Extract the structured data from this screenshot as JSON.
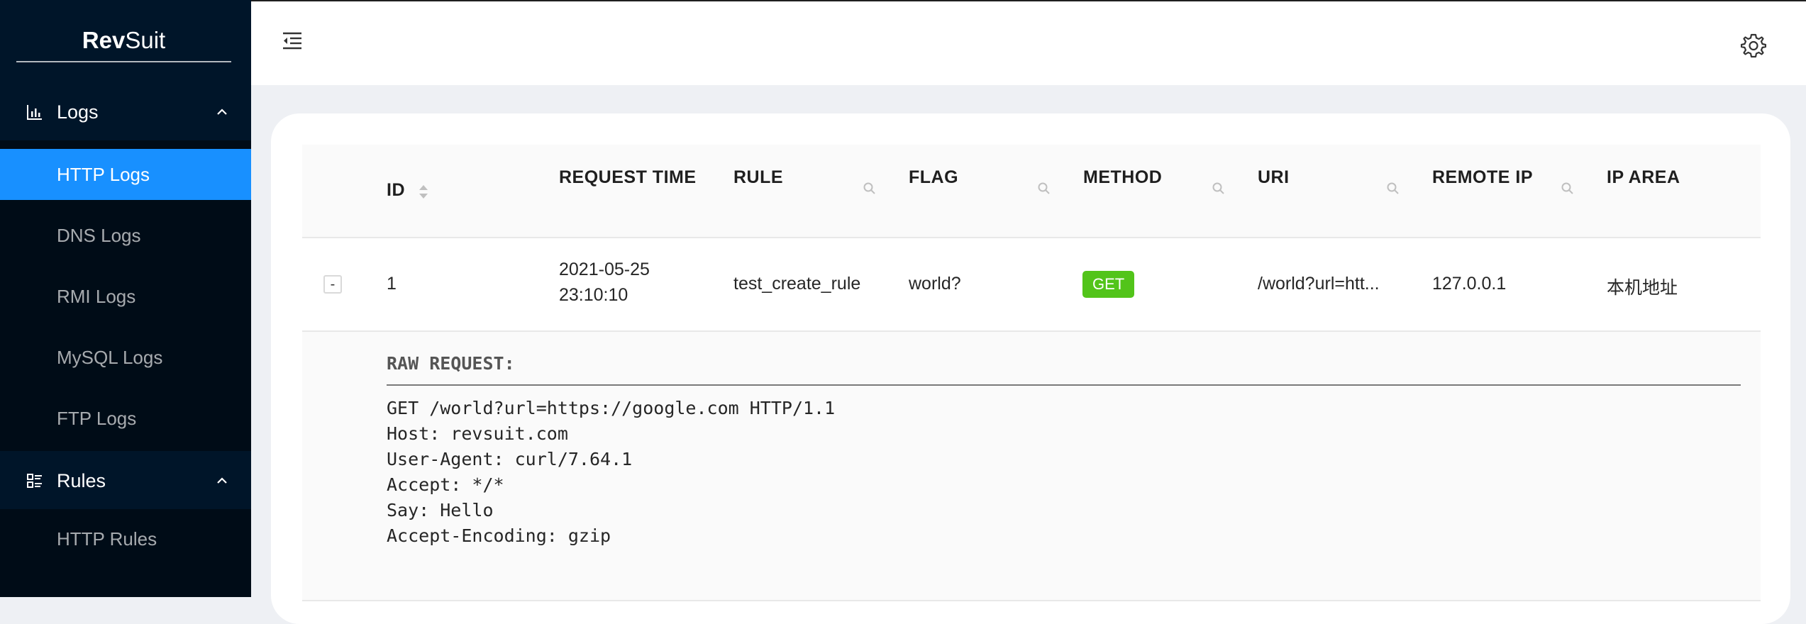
{
  "brand": {
    "bold": "Rev",
    "rest": "Suit"
  },
  "sidebar": {
    "groups": [
      {
        "label": "Logs",
        "icon": "bar-chart-icon",
        "items": [
          {
            "label": "HTTP Logs",
            "active": true
          },
          {
            "label": "DNS Logs"
          },
          {
            "label": "RMI Logs"
          },
          {
            "label": "MySQL Logs"
          },
          {
            "label": "FTP Logs"
          }
        ]
      },
      {
        "label": "Rules",
        "icon": "list-icon",
        "items": [
          {
            "label": "HTTP Rules"
          }
        ]
      }
    ]
  },
  "header": {
    "left_icon": "menu-fold-icon",
    "right_icon": "gear-icon"
  },
  "table": {
    "columns": [
      "ID",
      "REQUEST TIME",
      "RULE",
      "FLAG",
      "METHOD",
      "URI",
      "REMOTE IP",
      "IP AREA"
    ],
    "rows": [
      {
        "expand_symbol": "-",
        "id": "1",
        "time_date": "2021-05-25",
        "time_clock": "23:10:10",
        "rule": "test_create_rule",
        "flag": "world?",
        "method": "GET",
        "uri": "/world?url=htt...",
        "remote_ip": "127.0.0.1",
        "ip_area": "本机地址"
      }
    ],
    "expanded": {
      "title": "RAW REQUEST:",
      "body": "GET /world?url=https://google.com HTTP/1.1\nHost: revsuit.com\nUser-Agent: curl/7.64.1\nAccept: */*\nSay: Hello\nAccept-Encoding: gzip"
    }
  },
  "colors": {
    "sidebar_bg": "#001529",
    "submenu_bg": "#000c17",
    "active_item": "#1890ff",
    "method_get": "#52c41a"
  }
}
